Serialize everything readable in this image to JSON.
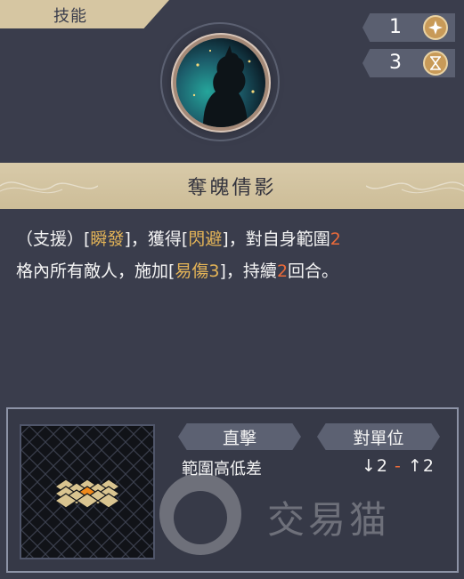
{
  "tab": {
    "label": "技能"
  },
  "counters": [
    {
      "value": "1",
      "icon": "sparkle-icon"
    },
    {
      "value": "3",
      "icon": "hourglass-icon"
    }
  ],
  "skill": {
    "name": "奪魄倩影",
    "description": {
      "p1": "（支援）[",
      "k1": "瞬發",
      "p2": "]，獲得[",
      "k2": "閃避",
      "p3": "]，對自身範圍",
      "n1": "2",
      "p4": "格內所有敵人，施加[",
      "k3": "易傷3",
      "p5": "]，持續",
      "n2": "2",
      "p6": "回合。"
    }
  },
  "info": {
    "tag_attack": "直擊",
    "tag_target": "對單位",
    "height_label": "範圍高低差",
    "height_down": "↓2",
    "height_dash": " - ",
    "height_up": "↑2"
  },
  "watermark": {
    "text": "交易猫"
  },
  "colors": {
    "background": "#3a3d4c",
    "banner": "#d6c6a2",
    "keyword": "#e4b457",
    "number": "#ea6a3a",
    "range_tile": "#d9c490",
    "range_center": "#f08a1c"
  }
}
